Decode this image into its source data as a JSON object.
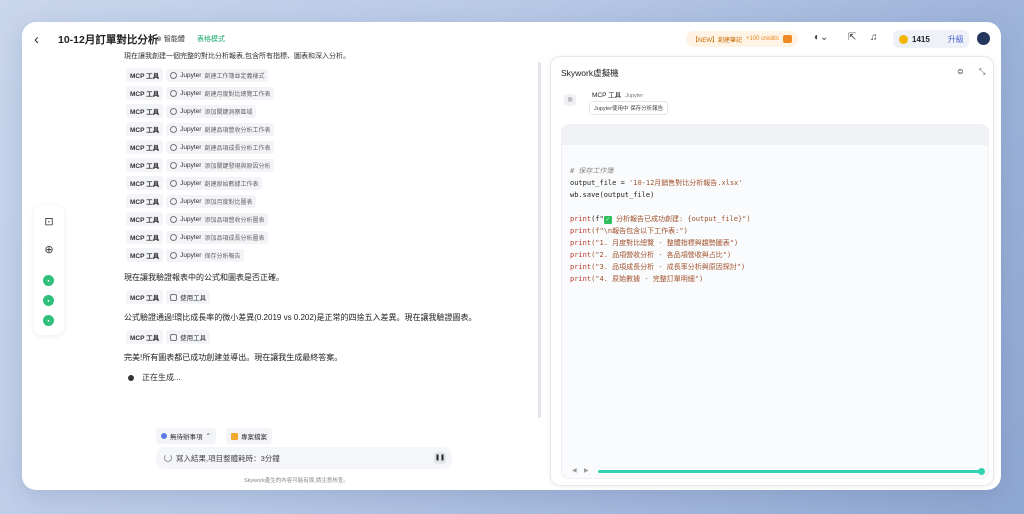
{
  "header": {
    "title": "10-12月訂單對比分析",
    "tag_agent": "智能體",
    "tag_mode": "表格模式",
    "new_label": "【NEW】創建筆記",
    "new_credits": "+100 credits",
    "credits": "1415",
    "upgrade": "升級"
  },
  "chat": {
    "top_line": "現在讓我創建一個完整的對比分析報表,包含所有指標、圖表和深入分析。",
    "steps": [
      {
        "tool": "MCP 工具",
        "chip": "Jupyter",
        "desc": "創建工作簿並定義樣式"
      },
      {
        "tool": "MCP 工具",
        "chip": "Jupyter",
        "desc": "創建月度對比總覽工作表"
      },
      {
        "tool": "MCP 工具",
        "chip": "Jupyter",
        "desc": "添加關鍵洞察區域"
      },
      {
        "tool": "MCP 工具",
        "chip": "Jupyter",
        "desc": "創建品項營收分析工作表"
      },
      {
        "tool": "MCP 工具",
        "chip": "Jupyter",
        "desc": "創建品項成長分析工作表"
      },
      {
        "tool": "MCP 工具",
        "chip": "Jupyter",
        "desc": "添加關鍵發現與原因分析"
      },
      {
        "tool": "MCP 工具",
        "chip": "Jupyter",
        "desc": "創建原始數據工作表"
      },
      {
        "tool": "MCP 工具",
        "chip": "Jupyter",
        "desc": "添加月度對比圖表"
      },
      {
        "tool": "MCP 工具",
        "chip": "Jupyter",
        "desc": "添加品項營收分析圖表"
      },
      {
        "tool": "MCP 工具",
        "chip": "Jupyter",
        "desc": "添加品項成長分析圖表"
      },
      {
        "tool": "MCP 工具",
        "chip": "Jupyter",
        "desc": "保存分析報告"
      }
    ],
    "para1": "現在讓我驗證報表中的公式和圖表是否正確。",
    "step_use1": {
      "tool": "MCP 工具",
      "chip": "使用工具"
    },
    "para2": "公式驗證通過!環比成長率的微小差異(0.2019 vs 0.202)是正常的四捨五入差異。現在讓我驗證圖表。",
    "step_use2": {
      "tool": "MCP 工具",
      "chip": "使用工具"
    },
    "para3": "完美!所有圖表都已成功創建並導出。現在讓我生成最終答案。",
    "generating": "正在生成...",
    "chip_pending": "無待辦事項",
    "chip_files": "專案檔案",
    "input_status": "寫入結果,項目整體耗時：3分鐘",
    "footer": "Skywork產生的內容可能有誤,請注意核查。"
  },
  "panel": {
    "title": "Skywork虛擬機",
    "tool_name": "MCP 工具",
    "tool_sub": "Jupyter",
    "tool_tag": "Jupyter使用中 保存分析報告",
    "code": {
      "comment": "# 保存工作簿",
      "l1a": "output_file = ",
      "l1b": "'10-12月銷售對比分析報告.xlsx'",
      "l2": "wb.save(output_file)",
      "p1a": "print",
      "p1b": "(f\"",
      "p1c": " 分析報告已成功創建: {output_file}\")",
      "p2": "(f\"\\n報告包含以下工作表:\")",
      "p3": "(\"1. 月度對比總覽 - 整體指標與趨勢圖表\")",
      "p4": "(\"2. 品項營收分析 - 各品項營收與占比\")",
      "p5": "(\"3. 品項成長分析 - 成長率分析與原因探討\")",
      "p6": "(\"4. 原始數據 - 完整訂單明細\")"
    },
    "progress": 1.0
  },
  "colors": {
    "accent_green": "#2fbf7a",
    "progress": "#2fd3b0",
    "upgrade": "#4a64d8"
  }
}
